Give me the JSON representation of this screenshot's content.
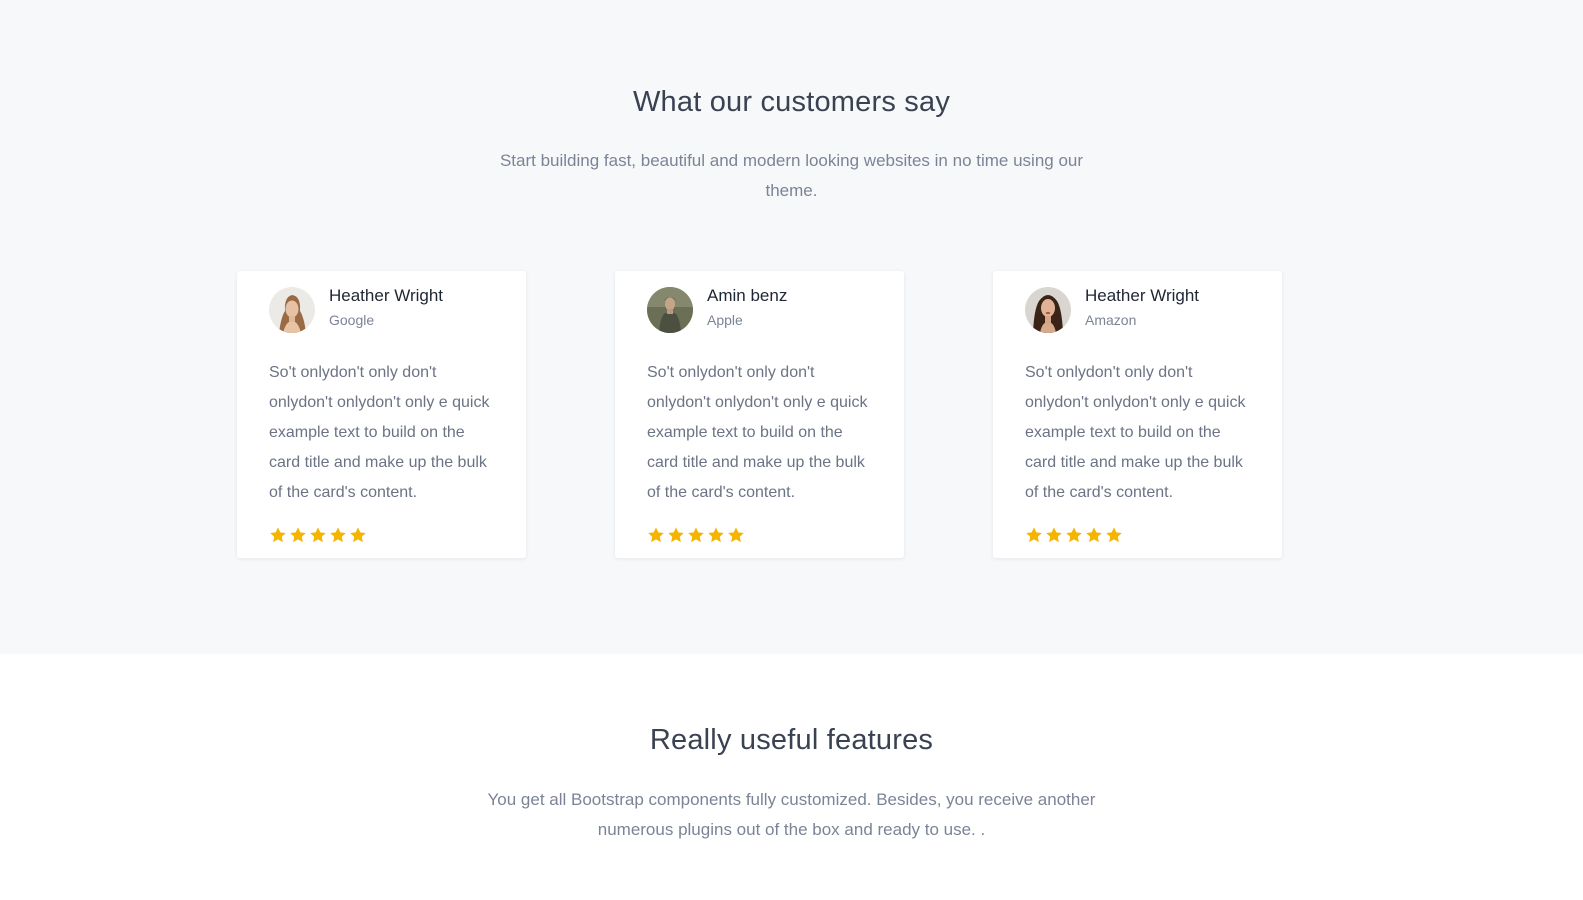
{
  "testimonials": {
    "title": "What our customers say",
    "subtitle": "Start building fast, beautiful and modern looking websites in no time using our theme.",
    "rating_color": "#f5b400",
    "cards": [
      {
        "name": "Heather Wright",
        "company": "Google",
        "quote": "So't onlydon't only don't onlydon't onlydon't only e quick example text to build on the card title and make up the bulk of the card's content.",
        "rating": 5
      },
      {
        "name": "Amin benz",
        "company": "Apple",
        "quote": "So't onlydon't only don't onlydon't onlydon't only e quick example text to build on the card title and make up the bulk of the card's content.",
        "rating": 5
      },
      {
        "name": "Heather Wright",
        "company": "Amazon",
        "quote": "So't onlydon't only don't onlydon't onlydon't only e quick example text to build on the card title and make up the bulk of the card's content.",
        "rating": 5
      }
    ]
  },
  "features": {
    "title": "Really useful features",
    "subtitle": "You get all Bootstrap components fully customized. Besides, you receive another numerous plugins out of the box and ready to use. ."
  }
}
